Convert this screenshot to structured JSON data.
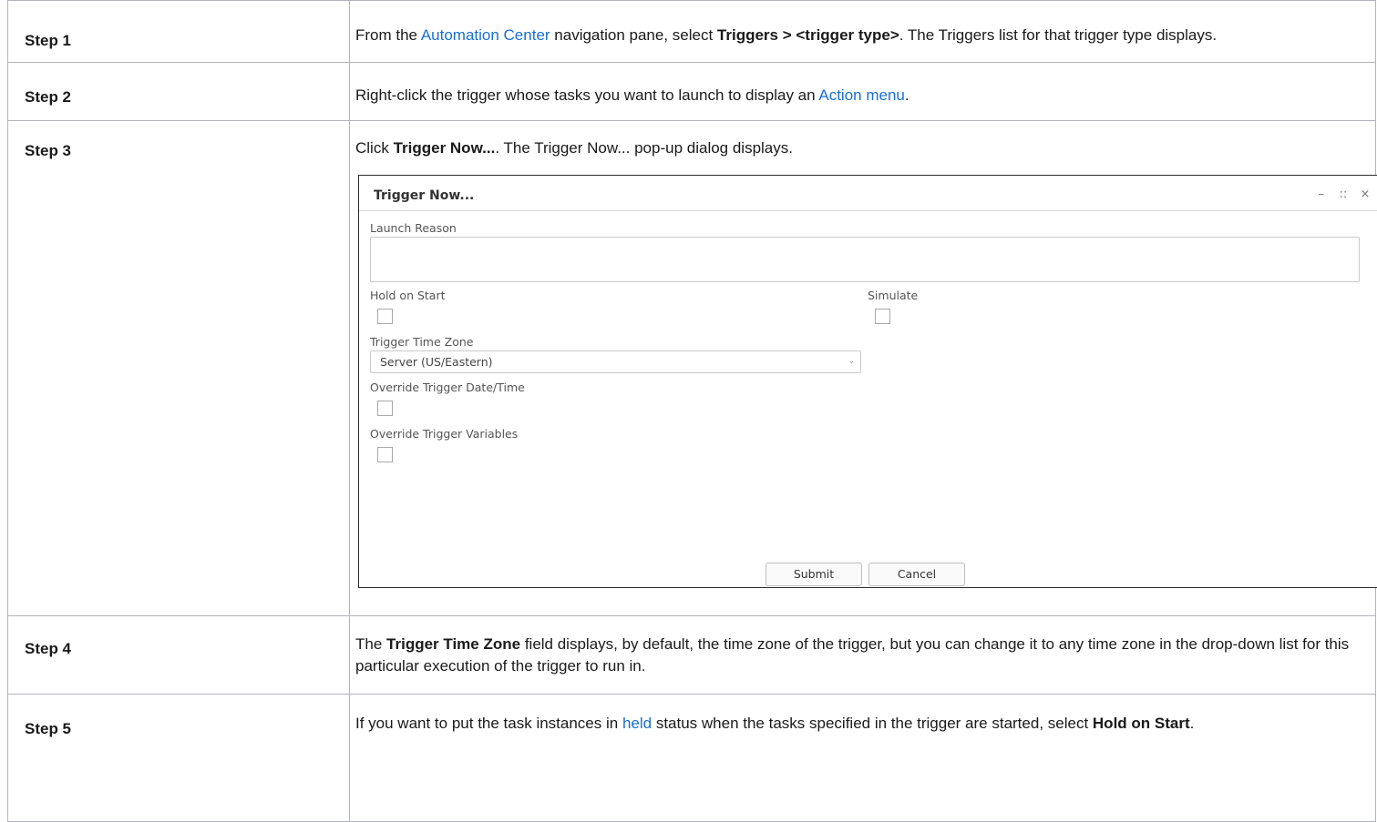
{
  "steps": [
    {
      "label": "Step 1",
      "parts": [
        {
          "t": "From the "
        },
        {
          "t": "Automation Center",
          "link": true
        },
        {
          "t": " navigation pane, select "
        },
        {
          "t": "Triggers > <trigger type>",
          "bold": true
        },
        {
          "t": ". The Triggers list for that trigger type displays."
        }
      ]
    },
    {
      "label": "Step 2",
      "parts": [
        {
          "t": "Right-click the trigger whose tasks you want to launch to display an "
        },
        {
          "t": "Action menu",
          "link": true
        },
        {
          "t": "."
        }
      ]
    },
    {
      "label": "Step 3",
      "parts": [
        {
          "t": "Click "
        },
        {
          "t": "Trigger Now...",
          "bold": true
        },
        {
          "t": ". The Trigger Now... pop-up dialog displays."
        }
      ]
    },
    {
      "label": "Step 4",
      "parts": [
        {
          "t": "The "
        },
        {
          "t": "Trigger Time Zone",
          "bold": true
        },
        {
          "t": " field displays, by default, the time zone of the trigger, but you can change it to any time zone in the drop-down list for this particular execution of the trigger to run in."
        }
      ]
    },
    {
      "label": "Step 5",
      "parts": [
        {
          "t": "If you want to put the task instances in "
        },
        {
          "t": "held",
          "link": true
        },
        {
          "t": " status when the tasks specified in the trigger are started, select "
        },
        {
          "t": "Hold on Start",
          "bold": true
        },
        {
          "t": "."
        }
      ]
    }
  ],
  "dialog": {
    "title": "Trigger Now...",
    "controls": {
      "minimize": "–",
      "maximize": "::",
      "close": "×"
    },
    "launch_reason_label": "Launch Reason",
    "hold_on_start_label": "Hold on Start",
    "simulate_label": "Simulate",
    "time_zone_label": "Trigger Time Zone",
    "time_zone_value": "Server (US/Eastern)",
    "override_datetime_label": "Override Trigger Date/Time",
    "override_variables_label": "Override Trigger Variables",
    "submit_label": "Submit",
    "cancel_label": "Cancel"
  },
  "colors": {
    "link": "#1a6fd1",
    "border": "#b3b3bf"
  }
}
